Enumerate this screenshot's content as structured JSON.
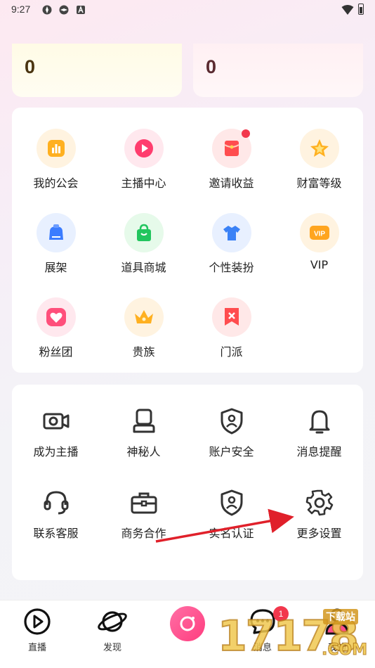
{
  "status_bar": {
    "time": "9:27"
  },
  "balances": [
    {
      "value": "0"
    },
    {
      "value": "0"
    }
  ],
  "features": [
    {
      "label": "我的公会",
      "icon": "guild-chart-icon"
    },
    {
      "label": "主播中心",
      "icon": "play-circle-icon"
    },
    {
      "label": "邀请收益",
      "icon": "red-envelope-icon"
    },
    {
      "label": "财富等级",
      "icon": "star-icon"
    },
    {
      "label": "展架",
      "icon": "shelf-bag-icon"
    },
    {
      "label": "道具商城",
      "icon": "shopping-bag-icon"
    },
    {
      "label": "个性装扮",
      "icon": "tshirt-icon"
    },
    {
      "label": "VIP",
      "icon": "vip-icon"
    },
    {
      "label": "粉丝团",
      "icon": "heart-icon"
    },
    {
      "label": "贵族",
      "icon": "crown-icon"
    },
    {
      "label": "门派",
      "icon": "banner-icon"
    }
  ],
  "settings": [
    {
      "label": "成为主播",
      "icon": "video-camera-icon"
    },
    {
      "label": "神秘人",
      "icon": "mystery-person-icon"
    },
    {
      "label": "账户安全",
      "icon": "shield-icon"
    },
    {
      "label": "消息提醒",
      "icon": "bell-icon"
    },
    {
      "label": "联系客服",
      "icon": "headset-icon"
    },
    {
      "label": "商务合作",
      "icon": "briefcase-icon"
    },
    {
      "label": "实名认证",
      "icon": "id-shield-icon"
    },
    {
      "label": "更多设置",
      "icon": "gear-icon"
    }
  ],
  "nav": {
    "live": "直播",
    "discover": "发现",
    "messages": "消息",
    "mine": "我的",
    "message_badge": "1"
  },
  "watermark": {
    "big": "17178",
    "small": "下载站",
    "com": ".COM"
  },
  "colors": {
    "accent_pink": "#ff3d7f",
    "badge_red": "#f2374c",
    "annotation_arrow": "#e0202a"
  }
}
